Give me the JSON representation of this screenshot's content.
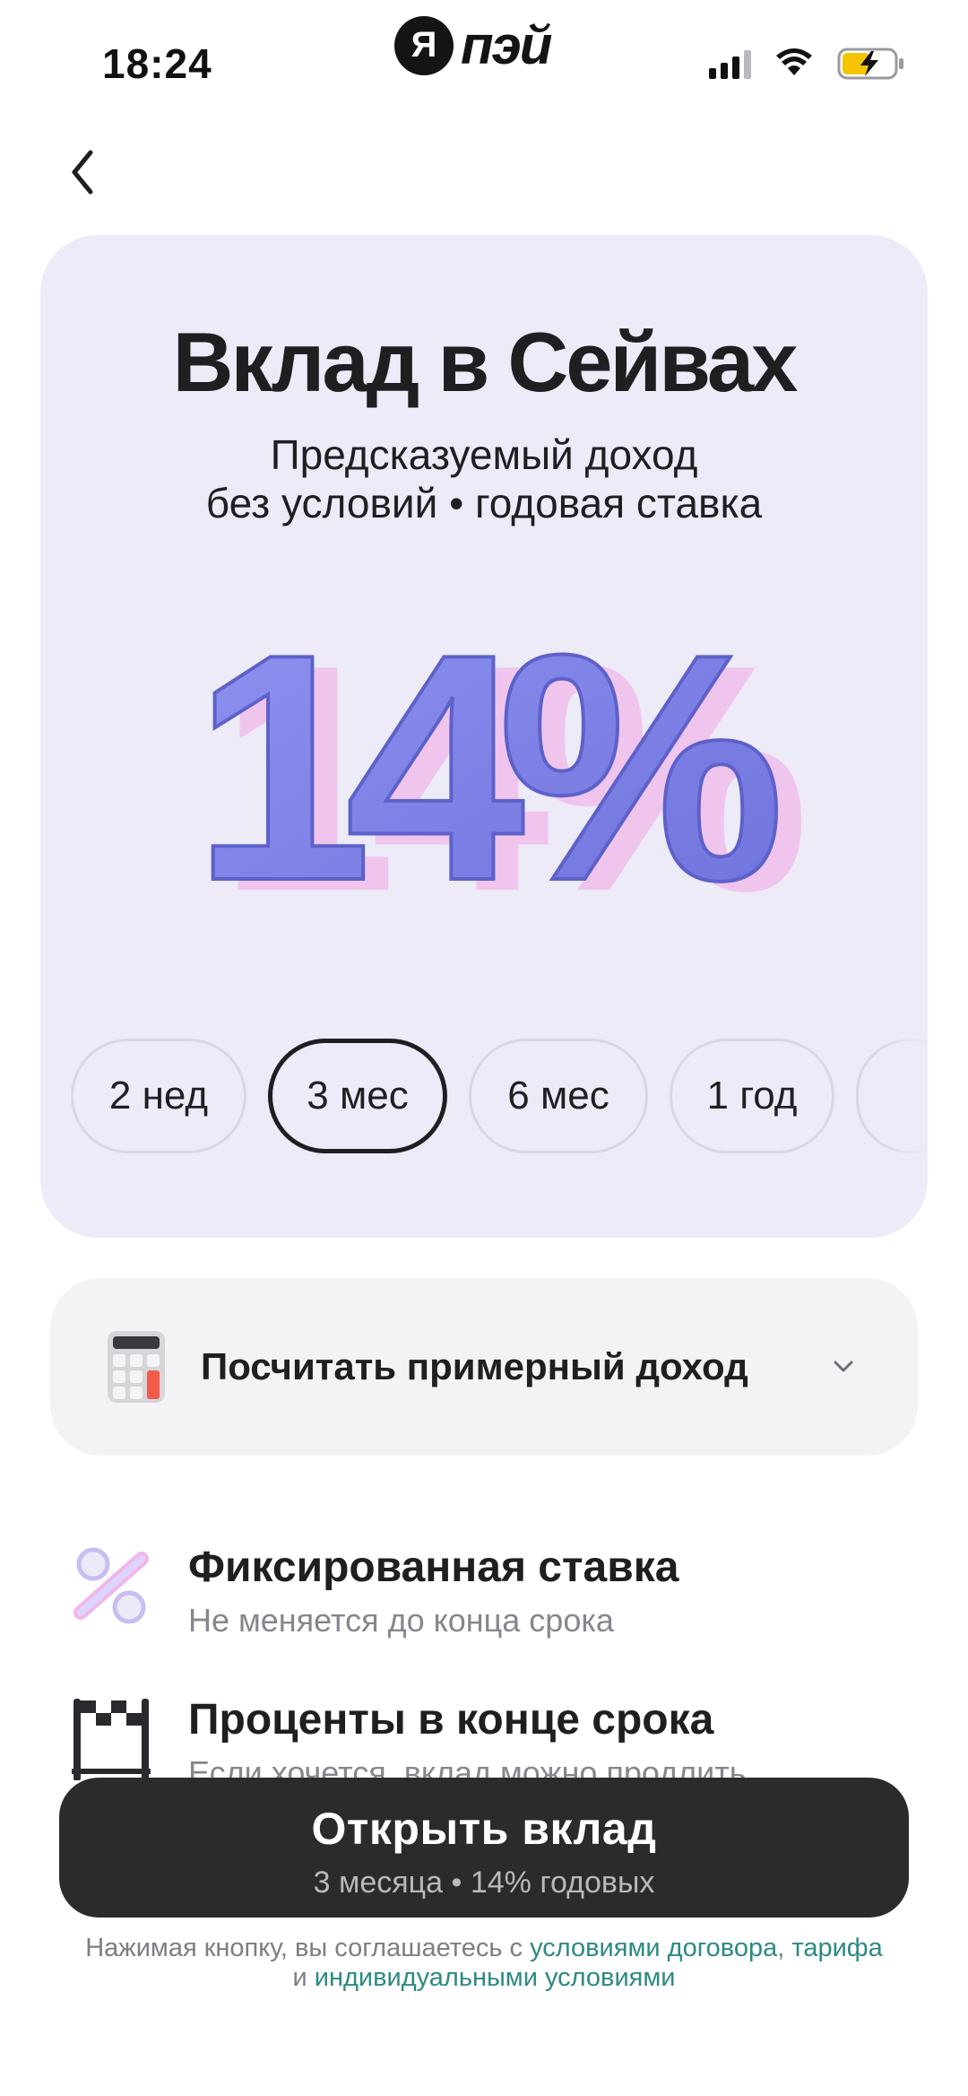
{
  "status_bar": {
    "time": "18:24",
    "brand_letter": "Я",
    "brand_name": "пэй"
  },
  "hero": {
    "title": "Вклад в Сейвах",
    "subtitle_line1": "Предсказуемый доход",
    "subtitle_line2": "без условий • годовая ставка",
    "rate": "14%",
    "rate_value_percent": 14
  },
  "terms": {
    "items": [
      "2 нед",
      "3 мес",
      "6 мес",
      "1 год"
    ],
    "selected": "3 мес"
  },
  "calculator": {
    "label": "Посчитать примерный доход"
  },
  "features": [
    {
      "title": "Фиксированная ставка",
      "subtitle": "Не меняется до конца срока"
    },
    {
      "title": "Проценты в конце срока",
      "subtitle": "Если хочется, вклад можно продлить"
    }
  ],
  "cta": {
    "title": "Открыть вклад",
    "subtitle": "3 месяца • 14% годовых"
  },
  "legal": {
    "prefix": "Нажимая кнопку, вы соглашаетесь с ",
    "link1": "условиями договора",
    "sep1": ", ",
    "link2": "тарифа",
    "sep2": " и ",
    "link3": "индивидуальными условиями"
  },
  "colors": {
    "hero_bg": "#ecebf7",
    "rate_fill": "#7b7fe6",
    "rate_glow": "#f2b6ea",
    "cta_bg": "#2b2b2e",
    "link": "#2c8a82"
  }
}
